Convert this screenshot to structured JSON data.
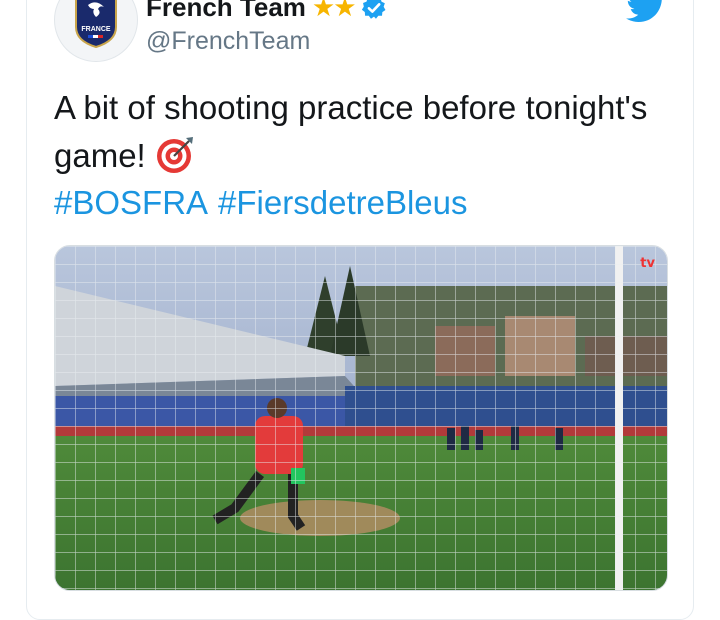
{
  "account": {
    "name": "French Team",
    "handle": "@FrenchTeam",
    "stars": "★★",
    "avatar_label": "FRANCE"
  },
  "tweet": {
    "text": "A bit of shooting practice before tonight's game!",
    "hashtags": [
      "#BOSFRA",
      "#FiersdetreBleus"
    ]
  },
  "media": {
    "badge": "tv"
  },
  "colors": {
    "link": "#1b95e0",
    "star": "#f7b500",
    "twitter": "#1da1f2"
  }
}
